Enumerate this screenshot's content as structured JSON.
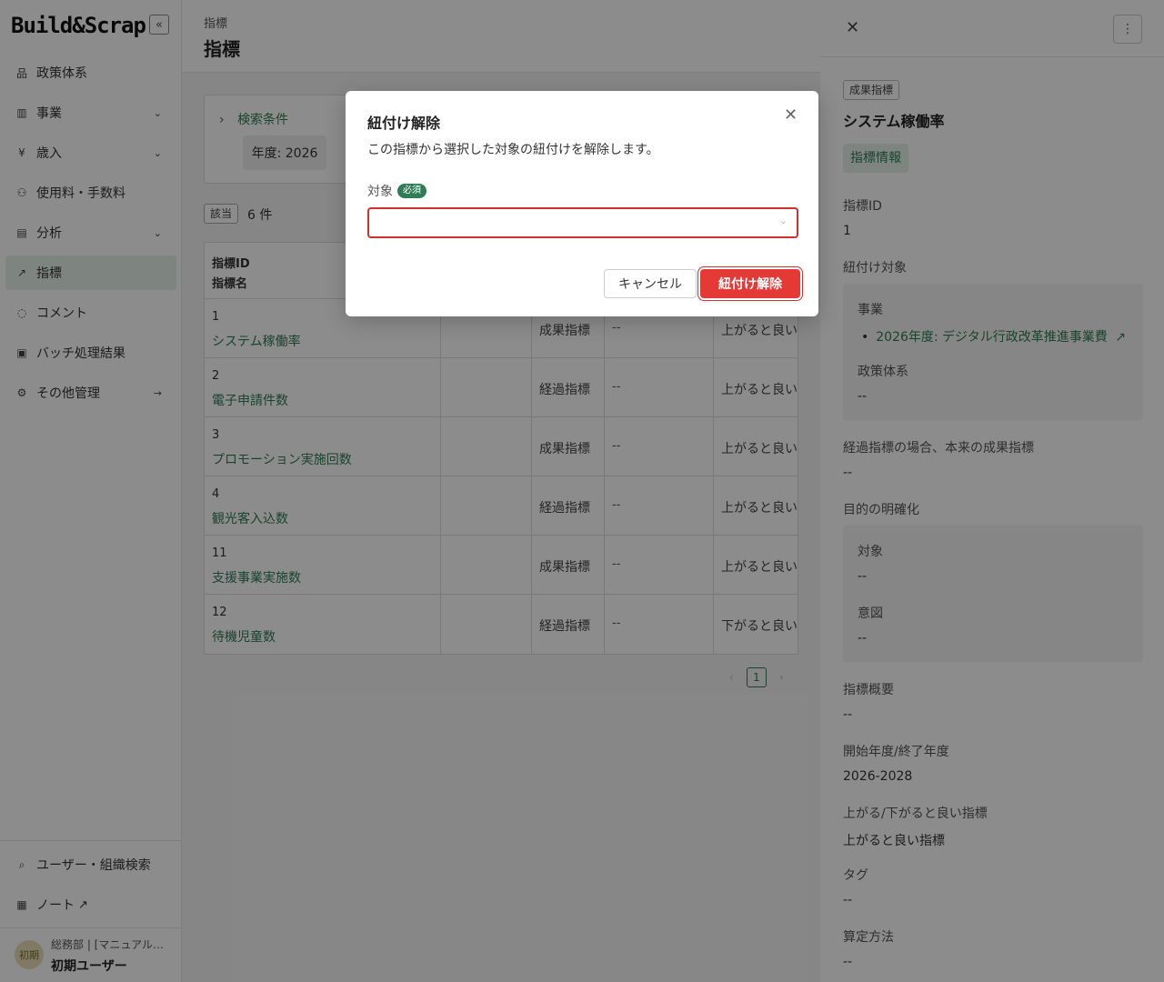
{
  "sidebar": {
    "logo": "Build&Scrap",
    "collapse_icon": "«",
    "items": [
      {
        "label": "政策体系",
        "icon": "品",
        "arrow": ""
      },
      {
        "label": "事業",
        "icon": "▥",
        "arrow": "⌄"
      },
      {
        "label": "歳入",
        "icon": "¥",
        "arrow": "⌄"
      },
      {
        "label": "使用料・手数料",
        "icon": "⚇",
        "arrow": ""
      },
      {
        "label": "分析",
        "icon": "▤",
        "arrow": "⌄"
      },
      {
        "label": "指標",
        "icon": "↗",
        "arrow": ""
      },
      {
        "label": "コメント",
        "icon": "◌",
        "arrow": ""
      },
      {
        "label": "バッチ処理結果",
        "icon": "▣",
        "arrow": ""
      },
      {
        "label": "その他管理",
        "icon": "⚙",
        "arrow": "→"
      }
    ],
    "bottom_items": [
      {
        "label": "ユーザー・組織検索",
        "icon": "⌕"
      },
      {
        "label": "ノート",
        "icon": "▦",
        "ext": "↗"
      }
    ],
    "user": {
      "avatar": "初期",
      "org": "総務部 | [マニュアル…",
      "name": "初期ユーザー"
    }
  },
  "main": {
    "breadcrumb": "指標",
    "title": "指標",
    "search": {
      "toggle": "検索条件",
      "chevron": "›",
      "year_chip": "年度: 2026"
    },
    "count_badge": "該当",
    "count_text": "6 件",
    "table": {
      "header_id": "指標ID",
      "header_name": "指標名",
      "rows": [
        {
          "id": "1",
          "name": "システム稼働率",
          "type": "成果指標",
          "dash": "--",
          "dir": "上がると良い"
        },
        {
          "id": "2",
          "name": "電子申請件数",
          "type": "経過指標",
          "dash": "--",
          "dir": "上がると良い"
        },
        {
          "id": "3",
          "name": "プロモーション実施回数",
          "type": "成果指標",
          "dash": "--",
          "dir": "上がると良い"
        },
        {
          "id": "4",
          "name": "観光客入込数",
          "type": "経過指標",
          "dash": "--",
          "dir": "上がると良い"
        },
        {
          "id": "11",
          "name": "支援事業実施数",
          "type": "成果指標",
          "dash": "--",
          "dir": "上がると良い"
        },
        {
          "id": "12",
          "name": "待機児童数",
          "type": "経過指標",
          "dash": "--",
          "dir": "下がると良い"
        }
      ]
    },
    "pager": {
      "prev": "‹",
      "page": "1",
      "next": "›"
    }
  },
  "panel": {
    "close": "✕",
    "more": "⋮",
    "type_tag": "成果指標",
    "title": "システム稼働率",
    "tab": "指標情報",
    "id_label": "指標ID",
    "id_value": "1",
    "link_label": "紐付け対象",
    "jigyo_label": "事業",
    "jigyo_item": "2026年度: デジタル行政改革推進事業費",
    "jigyo_ext": "↗",
    "policy_label": "政策体系",
    "policy_value": "--",
    "orig_label": "経過指標の場合、本来の成果指標",
    "orig_value": "--",
    "purpose_label": "目的の明確化",
    "target_label": "対象",
    "target_value": "--",
    "intent_label": "意図",
    "intent_value": "--",
    "summary_label": "指標概要",
    "summary_value": "--",
    "period_label": "開始年度/終了年度",
    "period_value": "2026-2028",
    "dir_label": "上がる/下がると良い指標",
    "dir_value": "上がると良い指標",
    "tag_label": "タグ",
    "tag_value": "--",
    "calc_label": "算定方法",
    "calc_value": "--"
  },
  "modal": {
    "title": "紐付け解除",
    "close": "✕",
    "description": "この指標から選択した対象の紐付けを解除します。",
    "field_label": "対象",
    "required": "必須",
    "select_value": "",
    "select_arrow": "⌄",
    "cancel": "キャンセル",
    "confirm": "紐付け解除"
  },
  "colors": {
    "accent": "#2e7d57",
    "danger": "#e53935",
    "error_border": "#d32f2f"
  }
}
